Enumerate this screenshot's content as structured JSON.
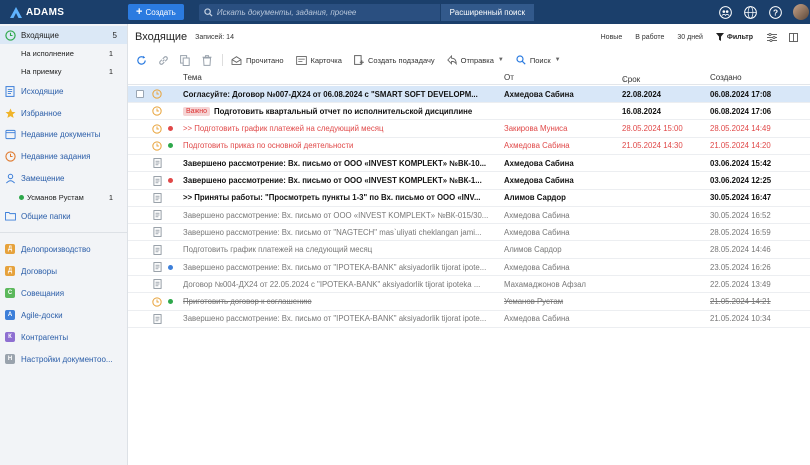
{
  "app": {
    "name": "ADAMS",
    "create_label": "Создать"
  },
  "search": {
    "placeholder": "Искать документы, задания, прочее",
    "advanced_label": "Расширенный поиск"
  },
  "colors": {
    "topbar": "#1b3f6b",
    "accent": "#2b7be0",
    "selected_row": "#d8e7f8",
    "red": "#e04848",
    "green": "#2ea84b",
    "blue": "#3d7fd9"
  },
  "sidebar": {
    "inbox": {
      "label": "Входящие",
      "count": "5"
    },
    "inbox_sub": [
      {
        "label": "На исполнение",
        "count": "1"
      },
      {
        "label": "На приемку",
        "count": "1"
      }
    ],
    "outbox": "Исходящие",
    "favorites": "Избранное",
    "recent_docs": "Недавние документы",
    "recent_tasks": "Недавние задания",
    "substitution": "Замещение",
    "substitution_sub": {
      "label": "Усманов Рустам",
      "count": "1"
    },
    "shared": "Общие папки",
    "sections": [
      {
        "letter": "Д",
        "label": "Делопроизводство",
        "color": "#e6a23c"
      },
      {
        "letter": "Д",
        "label": "Договоры",
        "color": "#e6a23c"
      },
      {
        "letter": "С",
        "label": "Совещания",
        "color": "#5cb85c"
      },
      {
        "letter": "A",
        "label": "Agile-доски",
        "color": "#3d7fd9"
      },
      {
        "letter": "К",
        "label": "Контрагенты",
        "color": "#8e6fd1"
      },
      {
        "letter": "Н",
        "label": "Настройки документоо...",
        "color": "#9aa3ad"
      }
    ]
  },
  "main": {
    "title": "Входящие",
    "records": "Записей: 14",
    "filters": [
      "Новые",
      "В работе",
      "30 дней"
    ],
    "filter_label": "Фильтр",
    "toolbar": {
      "read": "Прочитано",
      "card": "Карточка",
      "subtask": "Создать подзадачу",
      "send": "Отправка",
      "search": "Поиск"
    },
    "columns": {
      "subject": "Тема",
      "from": "От",
      "term": "Срок",
      "created": "Создано"
    }
  },
  "rows": [
    {
      "icon": "clock",
      "dot": "",
      "style": "bold sel",
      "badge": "",
      "subject": "Согласуйте: Договор №007-ДХ24 от 06.08.2024 с \"SMART SOFT DEVELOPM...",
      "from": "Ахмедова Сабина",
      "term": "22.08.2024",
      "created": "06.08.2024 17:08"
    },
    {
      "icon": "clock",
      "dot": "",
      "style": "bold",
      "badge": "Важно",
      "subject": "Подготовить квартальный отчет по исполнительской дисциплине",
      "from": "",
      "term": "16.08.2024",
      "created": "06.08.2024 17:06"
    },
    {
      "icon": "clock",
      "dot": "red",
      "style": "red",
      "badge": "",
      "subject": ">> Подготовить график платежей на следующий месяц",
      "from": "Закирова Муниса",
      "term": "28.05.2024 15:00",
      "created": "28.05.2024 14:49"
    },
    {
      "icon": "clock",
      "dot": "green",
      "style": "red",
      "badge": "",
      "subject": "Подготовить приказ по основной деятельности",
      "from": "Ахмедова Сабина",
      "term": "21.05.2024 14:30",
      "created": "21.05.2024 14:20"
    },
    {
      "icon": "doc",
      "dot": "",
      "style": "bold",
      "badge": "",
      "subject": "Завершено рассмотрение: Вх. письмо от ООО «INVEST KOMPLEKT» №ВК-10...",
      "from": "Ахмедова Сабина",
      "term": "",
      "created": "03.06.2024 15:42"
    },
    {
      "icon": "doc",
      "dot": "red",
      "style": "bold",
      "badge": "",
      "subject": "Завершено рассмотрение: Вх. письмо от ООО «INVEST KOMPLEKT» №ВК-1...",
      "from": "Ахмедова Сабина",
      "term": "",
      "created": "03.06.2024 12:25"
    },
    {
      "icon": "doc",
      "dot": "",
      "style": "bold",
      "badge": "",
      "subject": ">> Приняты работы: \"Просмотреть пункты 1-3\" по Вх. письмо от ООО «INV...",
      "from": "Алимов Сардор",
      "term": "",
      "created": "30.05.2024 16:47"
    },
    {
      "icon": "doc",
      "dot": "",
      "style": "gray",
      "badge": "",
      "subject": "Завершено рассмотрение: Вх. письмо от ООО «INVEST KOMPLEKT» №ВК-015/30...",
      "from": "Ахмедова Сабина",
      "term": "",
      "created": "30.05.2024 16:52"
    },
    {
      "icon": "doc",
      "dot": "",
      "style": "gray",
      "badge": "",
      "subject": "Завершено рассмотрение: Вх. письмо от \"NAGTECH\" mas`uliyati cheklangan jami...",
      "from": "Ахмедова Сабина",
      "term": "",
      "created": "28.05.2024 16:59"
    },
    {
      "icon": "doc",
      "dot": "",
      "style": "gray",
      "badge": "",
      "subject": "Подготовить график платежей на следующий месяц",
      "from": "Алимов Сардор",
      "term": "",
      "created": "28.05.2024 14:46"
    },
    {
      "icon": "doc",
      "dot": "blue",
      "style": "gray",
      "badge": "",
      "subject": "Завершено рассмотрение: Вх. письмо от \"IPOTEKA-BANK\" aksiyadorlik tijorat ipote...",
      "from": "Ахмедова Сабина",
      "term": "",
      "created": "23.05.2024 16:26"
    },
    {
      "icon": "doc",
      "dot": "",
      "style": "gray",
      "badge": "",
      "subject": "Договор №004-ДХ24 от 22.05.2024 с \"IPOTEKA-BANK\" aksiyadorlik tijorat ipoteka ...",
      "from": "Махамаджонов Афзал",
      "term": "",
      "created": "22.05.2024 13:49"
    },
    {
      "icon": "clock",
      "dot": "green",
      "style": "gray strike",
      "badge": "",
      "subject": "Приготовить договор к соглашению",
      "from": "Усманов Рустам",
      "term": "",
      "created": "21.05.2024 14:21"
    },
    {
      "icon": "doc",
      "dot": "",
      "style": "gray",
      "badge": "",
      "subject": "Завершено рассмотрение: Вх. письмо от \"IPOTEKA-BANK\" aksiyadorlik tijorat ipote...",
      "from": "Ахмедова Сабина",
      "term": "",
      "created": "21.05.2024 10:34"
    }
  ]
}
